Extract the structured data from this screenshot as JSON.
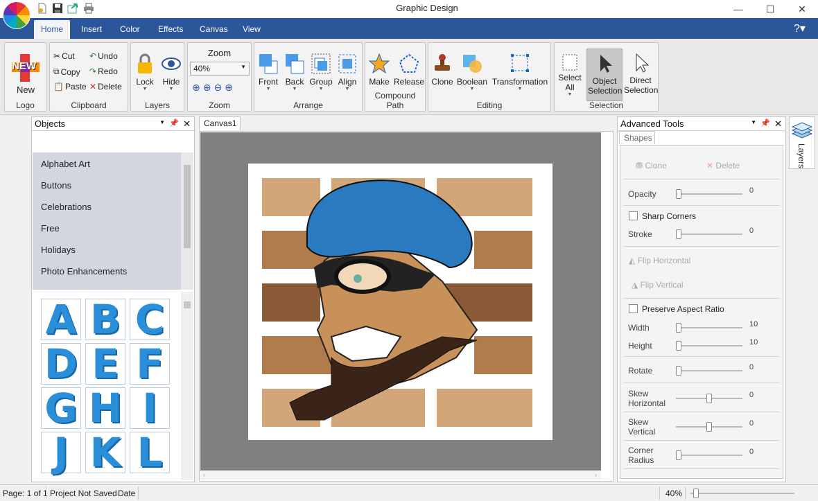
{
  "window": {
    "title": "Graphic Design",
    "minimize": "—",
    "maximize": "☐",
    "close": "✕"
  },
  "tabs": [
    {
      "label": "Home",
      "active": true
    },
    {
      "label": "Insert"
    },
    {
      "label": "Color"
    },
    {
      "label": "Effects"
    },
    {
      "label": "Canvas"
    },
    {
      "label": "View"
    }
  ],
  "help": {
    "label": "?▾"
  },
  "ribbon": {
    "logo": {
      "new": "New",
      "badge": "NEW",
      "group": "Logo"
    },
    "clipboard": {
      "cut": "Cut",
      "copy": "Copy",
      "paste": "Paste",
      "undo": "Undo",
      "redo": "Redo",
      "delete": "Delete",
      "group": "Clipboard"
    },
    "layers": {
      "lock": "Lock",
      "hide": "Hide",
      "group": "Layers"
    },
    "zoom": {
      "title": "Zoom",
      "value": "40%",
      "group": "Zoom"
    },
    "arrange": {
      "front": "Front",
      "back": "Back",
      "group_btn": "Group",
      "align": "Align",
      "group": "Arrange"
    },
    "compound": {
      "make": "Make",
      "release": "Release",
      "group": "Compound Path"
    },
    "editing": {
      "clone": "Clone",
      "boolean": "Boolean",
      "transformation": "Transformation",
      "group": "Editing"
    },
    "selection": {
      "select_all": "Select All",
      "object_selection": "Object Selection",
      "direct_selection": "Direct Selection",
      "group": "Selection"
    }
  },
  "objects_panel": {
    "title": "Objects",
    "categories": [
      "Alphabet Art",
      "Buttons",
      "Celebrations",
      "Free",
      "Holidays",
      "Photo Enhancements"
    ],
    "letters": [
      "A",
      "B",
      "C",
      "D",
      "E",
      "F",
      "G",
      "H",
      "I",
      "J",
      "K",
      "L"
    ]
  },
  "canvas": {
    "tab": "Canvas1"
  },
  "advanced": {
    "title": "Advanced Tools",
    "tab": "Shapes",
    "clone": "Clone",
    "delete": "Delete",
    "opacity": {
      "label": "Opacity",
      "value": "0"
    },
    "sharp_corners": "Sharp Corners",
    "stroke": {
      "label": "Stroke",
      "value": "0"
    },
    "flip_h": "Flip Horizontal",
    "flip_v": "Flip Vertical",
    "preserve": "Preserve Aspect Ratio",
    "width": {
      "label": "Width",
      "value": "10"
    },
    "height": {
      "label": "Height",
      "value": "10"
    },
    "rotate": {
      "label": "Rotate",
      "value": "0"
    },
    "skew_h": {
      "label1": "Skew",
      "label2": "Horizontal",
      "value": "0"
    },
    "skew_v": {
      "label1": "Skew",
      "label2": "Vertical",
      "value": "0"
    },
    "corner": {
      "label1": "Corner",
      "label2": "Radius",
      "value": "0"
    }
  },
  "layers_side_tab": "Layers",
  "status": {
    "page": "Page: 1 of 1",
    "saved": "Project Not Saved",
    "date": "Date",
    "zoom": "40%"
  }
}
